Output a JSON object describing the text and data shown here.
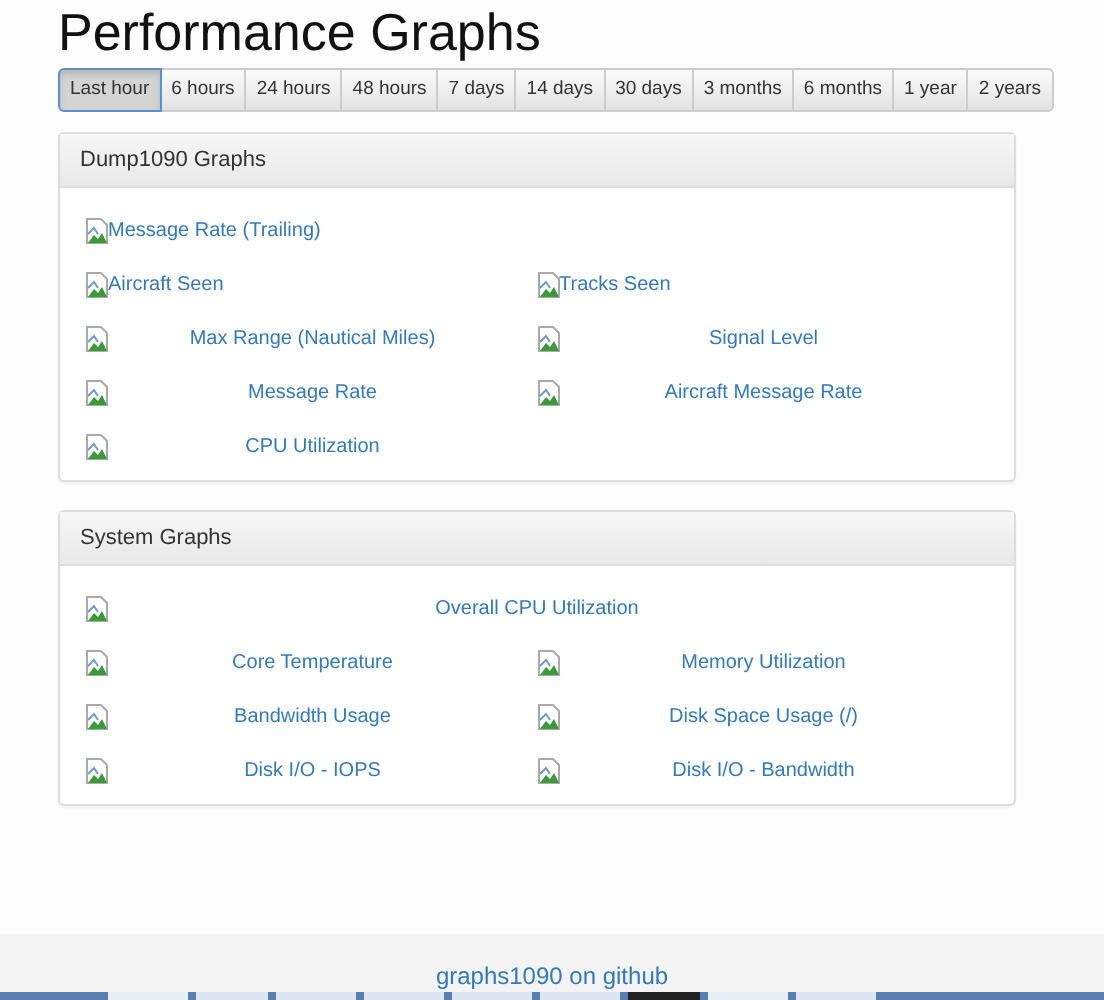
{
  "title": "Performance Graphs",
  "ranges": [
    {
      "label": "Last hour",
      "selected": true
    },
    {
      "label": "6 hours",
      "selected": false
    },
    {
      "label": "24 hours",
      "selected": false
    },
    {
      "label": "48 hours",
      "selected": false
    },
    {
      "label": "7 days",
      "selected": false
    },
    {
      "label": "14 days",
      "selected": false
    },
    {
      "label": "30 days",
      "selected": false
    },
    {
      "label": "3 months",
      "selected": false
    },
    {
      "label": "6 months",
      "selected": false
    },
    {
      "label": "1 year",
      "selected": false
    },
    {
      "label": "2 years",
      "selected": false
    }
  ],
  "panels": [
    {
      "title": "Dump1090 Graphs",
      "graphs": [
        {
          "label": "Message Rate (Trailing)",
          "kind": "inline-wide"
        },
        {
          "label": "Aircraft Seen",
          "kind": "inline"
        },
        {
          "label": "Tracks Seen",
          "kind": "inline"
        },
        {
          "label": "Max Range (Nautical Miles)",
          "kind": "centered"
        },
        {
          "label": "Signal Level",
          "kind": "centered"
        },
        {
          "label": "Message Rate",
          "kind": "centered"
        },
        {
          "label": "Aircraft Message Rate",
          "kind": "centered"
        },
        {
          "label": "CPU Utilization",
          "kind": "centered"
        }
      ]
    },
    {
      "title": "System Graphs",
      "graphs": [
        {
          "label": "Overall CPU Utilization",
          "kind": "centered-wide"
        },
        {
          "label": "Core Temperature",
          "kind": "centered"
        },
        {
          "label": "Memory Utilization",
          "kind": "centered"
        },
        {
          "label": "Bandwidth Usage",
          "kind": "centered"
        },
        {
          "label": "Disk Space Usage (/)",
          "kind": "centered"
        },
        {
          "label": "Disk I/O - IOPS",
          "kind": "centered"
        },
        {
          "label": "Disk I/O - Bandwidth",
          "kind": "centered"
        }
      ]
    }
  ],
  "footer": {
    "link": "graphs1090 on github"
  }
}
